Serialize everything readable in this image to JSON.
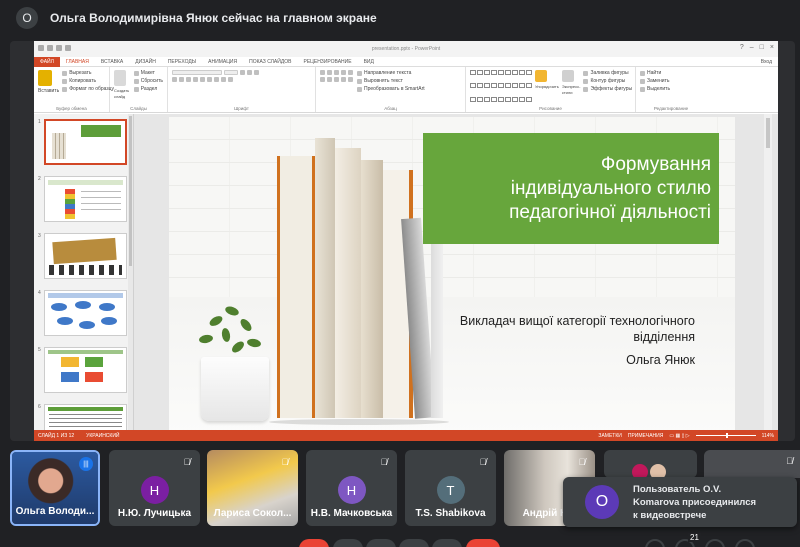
{
  "presenter_bar": {
    "avatar_letter": "О",
    "text": "Ольга Володимирівна Янюк сейчас на главном экране"
  },
  "powerpoint": {
    "file_title": "presentation.pptx - PowerPoint",
    "signin": "Вход",
    "tabs": [
      "ФАЙЛ",
      "ГЛАВНАЯ",
      "ВСТАВКА",
      "ДИЗАЙН",
      "ПЕРЕХОДЫ",
      "АНИМАЦИЯ",
      "ПОКАЗ СЛАЙДОВ",
      "РЕЦЕНЗИРОВАНИЕ",
      "ВИД"
    ],
    "ribbon": {
      "clipboard": {
        "label": "Буфер обмена",
        "paste": "Вставить",
        "cut": "Вырезать",
        "copy": "Копировать",
        "format_painter": "Формат по образцу"
      },
      "slides": {
        "label": "Слайды",
        "new_slide": "Создать слайд",
        "layout": "Макет",
        "reset": "Сбросить",
        "section": "Раздел"
      },
      "font": {
        "label": "Шрифт"
      },
      "paragraph": {
        "label": "Абзац",
        "direction": "Направление текста",
        "align": "Выровнять текст",
        "smartart": "Преобразовать в SmartArt"
      },
      "drawing": {
        "label": "Рисование",
        "arrange": "Упорядочить",
        "quick_styles": "Экспресс-стили",
        "fill": "Заливка фигуры",
        "outline": "Контур фигуры",
        "effects": "Эффекты фигуры"
      },
      "editing": {
        "label": "Редактирование",
        "find": "Найти",
        "replace": "Заменить",
        "select": "Выделить"
      }
    },
    "thumbnails": [
      "1",
      "2",
      "3",
      "4",
      "5",
      "6"
    ],
    "slide": {
      "title_lines": [
        "Формування",
        "індивідуального стилю",
        "педагогічної діяльності"
      ],
      "subtitle_lines": [
        "Викладач вищої категорії технологічного",
        "відділення"
      ],
      "author": "Ольга Янюк"
    },
    "status": {
      "slide_info": "СЛАЙД 1 ИЗ 12",
      "language": "УКРАИНСКИЙ",
      "notes": "ЗАМЕТКИ",
      "comments": "ПРИМЕЧАНИЯ",
      "zoom": "114%"
    }
  },
  "participants": [
    {
      "name": "Ольга Володи...",
      "type": "self",
      "color": "#1a73e8"
    },
    {
      "name": "Н.Ю. Лучицька",
      "letter": "Н",
      "color": "#7b1fa2",
      "muted": true
    },
    {
      "name": "Лариса Сокол...",
      "type": "photo",
      "muted": true
    },
    {
      "name": "Н.В. Мачковська",
      "letter": "Н",
      "color": "#7e57c2",
      "muted": true
    },
    {
      "name": "T.S. Shabikova",
      "letter": "T",
      "color": "#546e7a",
      "muted": true
    },
    {
      "name": "Андрій Юр",
      "type": "photo",
      "muted": true
    }
  ],
  "toast": {
    "letter": "O",
    "line1": "Пользователь O.V.",
    "line2": "Komarova присоединился",
    "line3": "к видеовстрече"
  },
  "controls": {
    "participants_count": "21"
  }
}
